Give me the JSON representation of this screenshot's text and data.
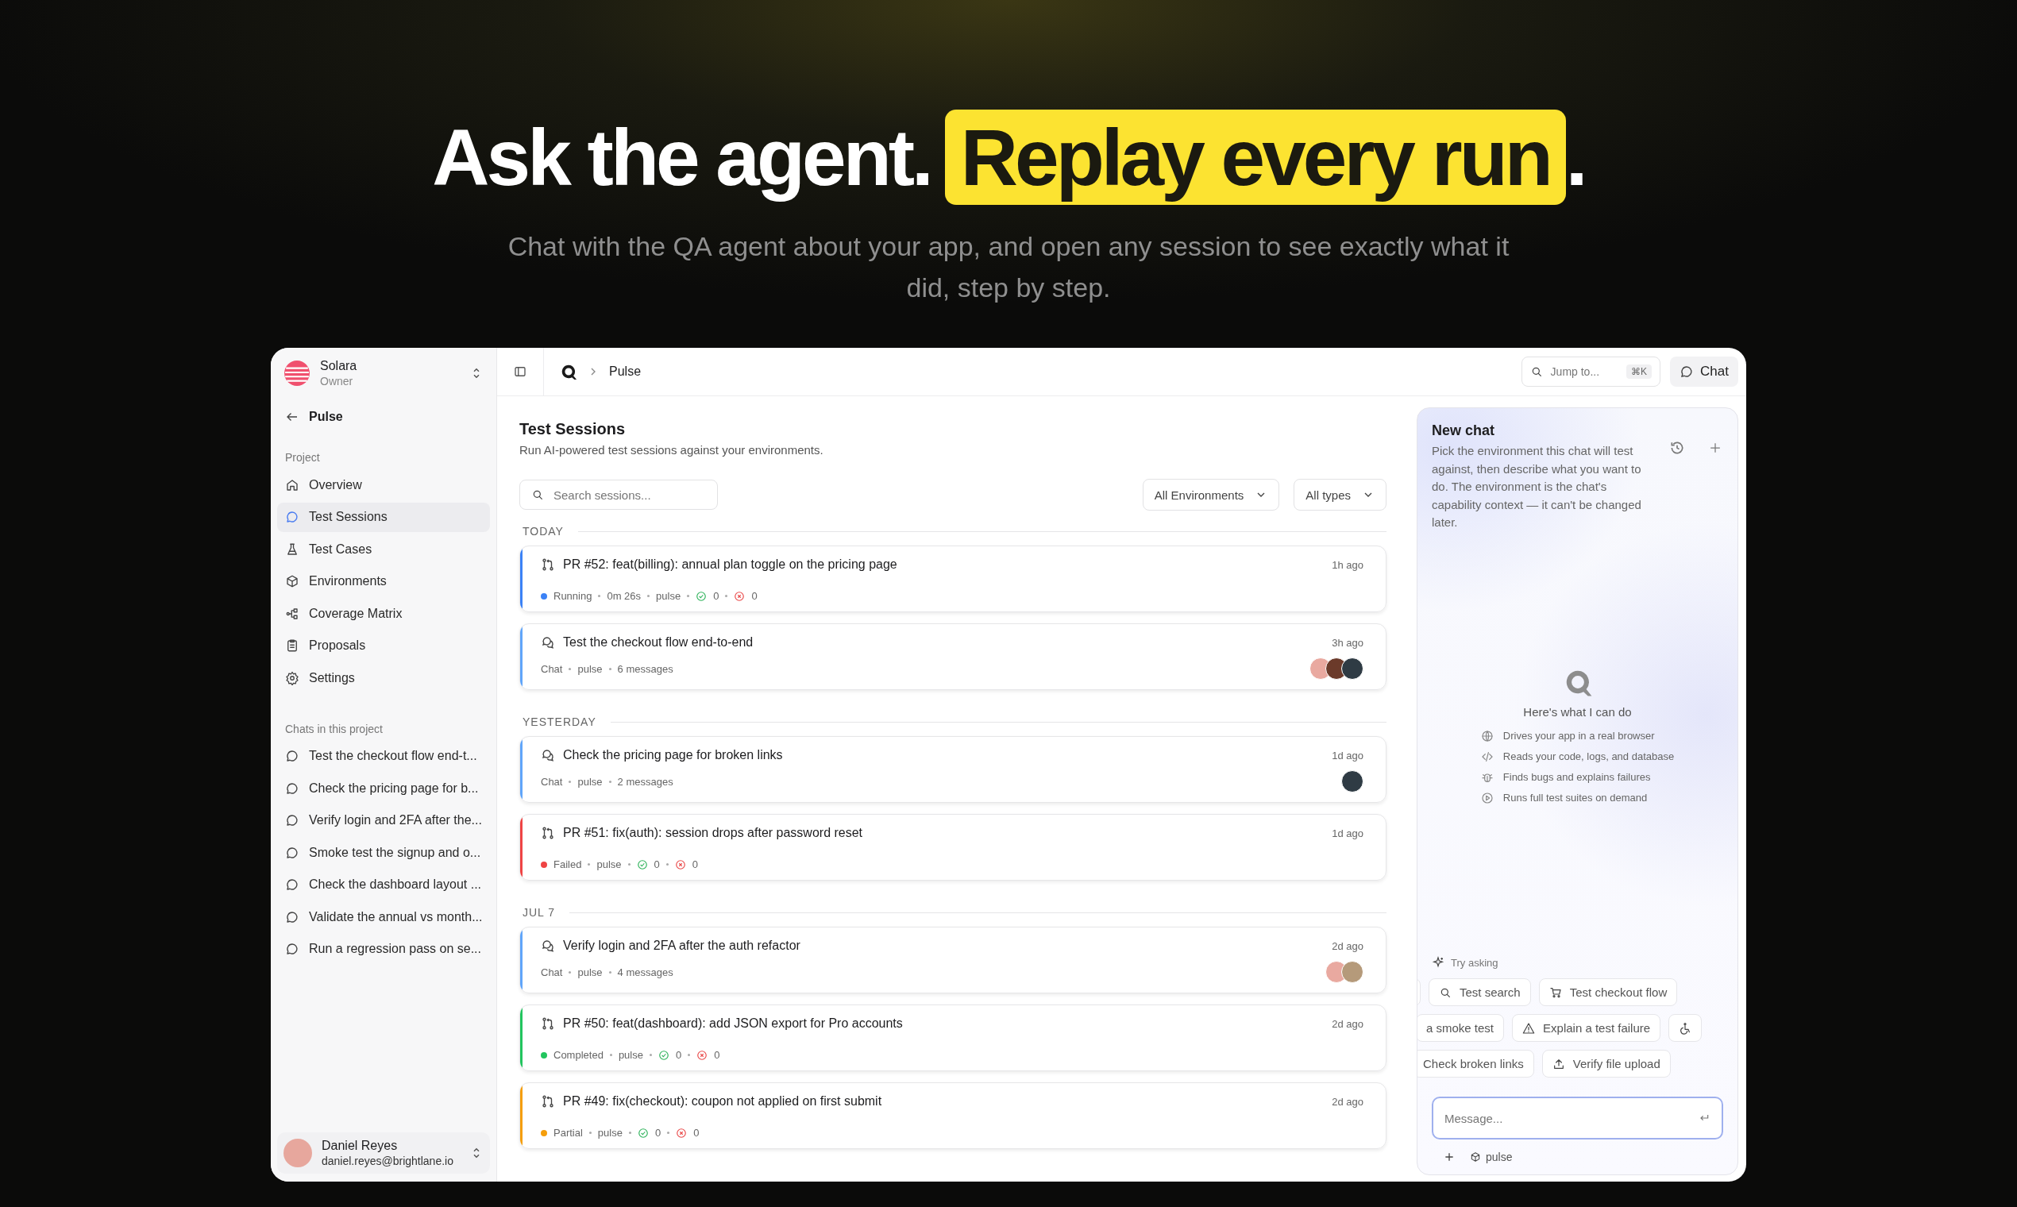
{
  "hero": {
    "title_start": "Ask the agent.",
    "title_highlight": "Replay every run",
    "title_end": ".",
    "subtitle": "Chat with the QA agent about your app, and open any session to see exactly what it did, step by step."
  },
  "sidebar": {
    "workspace": {
      "name": "Solara",
      "role": "Owner"
    },
    "back_label": "Pulse",
    "project_heading": "Project",
    "nav": [
      {
        "label": "Overview",
        "selected": false
      },
      {
        "label": "Test Sessions",
        "selected": true
      },
      {
        "label": "Test Cases",
        "selected": false
      },
      {
        "label": "Environments",
        "selected": false
      },
      {
        "label": "Coverage Matrix",
        "selected": false
      },
      {
        "label": "Proposals",
        "selected": false
      },
      {
        "label": "Settings",
        "selected": false
      }
    ],
    "chats_heading": "Chats in this project",
    "chats": [
      "Test the checkout flow end-t...",
      "Check the pricing page for b...",
      "Verify login and 2FA after the...",
      "Smoke test the signup and o...",
      "Check the dashboard layout ...",
      "Validate the annual vs month...",
      "Run a regression pass on se..."
    ],
    "user": {
      "name": "Daniel Reyes",
      "email": "daniel.reyes@brightlane.io"
    }
  },
  "header": {
    "breadcrumb": "Pulse",
    "jump_placeholder": "Jump to...",
    "shortcut": "⌘K",
    "chat_button": "Chat"
  },
  "main": {
    "title": "Test Sessions",
    "subtitle": "Run AI-powered test sessions against your environments.",
    "search_placeholder": "Search sessions...",
    "filters": [
      "All Environments",
      "All types"
    ],
    "groups": [
      {
        "label": "TODAY",
        "sessions": [
          {
            "kind": "pr",
            "title": "PR #52: feat(billing): annual plan toggle on the pricing page",
            "time": "1h ago",
            "color": "#3b82f6",
            "status": "Running",
            "duration": "0m 26s",
            "env": "pulse",
            "passed": "0",
            "failed": "0"
          },
          {
            "kind": "chat",
            "title": "Test the checkout flow end-to-end",
            "time": "3h ago",
            "color": "#60a5fa",
            "type_label": "Chat",
            "env": "pulse",
            "messages": "6 messages",
            "avatars": [
              {
                "color": "#e9a9a0"
              },
              {
                "color": "#6b3a2a"
              },
              {
                "color": "#2f3b44"
              }
            ]
          }
        ]
      },
      {
        "label": "YESTERDAY",
        "sessions": [
          {
            "kind": "chat",
            "title": "Check the pricing page for broken links",
            "time": "1d ago",
            "color": "#60a5fa",
            "type_label": "Chat",
            "env": "pulse",
            "messages": "2 messages",
            "avatars": [
              {
                "color": "#2f3b44"
              }
            ]
          },
          {
            "kind": "pr",
            "title": "PR #51: fix(auth): session drops after password reset",
            "time": "1d ago",
            "color": "#ef4444",
            "status": "Failed",
            "env": "pulse",
            "passed": "0",
            "failed": "0"
          }
        ]
      },
      {
        "label": "JUL 7",
        "sessions": [
          {
            "kind": "chat",
            "title": "Verify login and 2FA after the auth refactor",
            "time": "2d ago",
            "color": "#60a5fa",
            "type_label": "Chat",
            "env": "pulse",
            "messages": "4 messages",
            "avatars": [
              {
                "color": "#e9a9a0"
              },
              {
                "color": "#b59a7a"
              }
            ]
          },
          {
            "kind": "pr",
            "title": "PR #50: feat(dashboard): add JSON export for Pro accounts",
            "time": "2d ago",
            "color": "#22c55e",
            "status": "Completed",
            "env": "pulse",
            "passed": "0",
            "failed": "0"
          },
          {
            "kind": "pr",
            "title": "PR #49: fix(checkout): coupon not applied on first submit",
            "time": "2d ago",
            "color": "#f59e0b",
            "status": "Partial",
            "env": "pulse",
            "passed": "0",
            "failed": "0"
          }
        ]
      }
    ]
  },
  "chat": {
    "title": "New chat",
    "description": "Pick the environment this chat will test against, then describe what you want to do. The environment is the chat's capability context — it can't be changed later.",
    "capabilities_heading": "Here's what I can do",
    "capabilities": [
      "Drives your app in a real browser",
      "Reads your code, logs, and database",
      "Finds bugs and explains failures",
      "Runs full test suites on demand"
    ],
    "try_label": "Try asking",
    "chip_rows": [
      [
        {},
        {
          "label": "Test search"
        },
        {
          "label": "Test checkout flow"
        }
      ],
      [
        {
          "label": "a smoke test"
        },
        {
          "label": "Explain a test failure"
        },
        {}
      ],
      [
        {
          "label": "Check broken links"
        },
        {
          "label": "Verify file upload"
        }
      ]
    ],
    "message_placeholder": "Message...",
    "env": "pulse"
  }
}
